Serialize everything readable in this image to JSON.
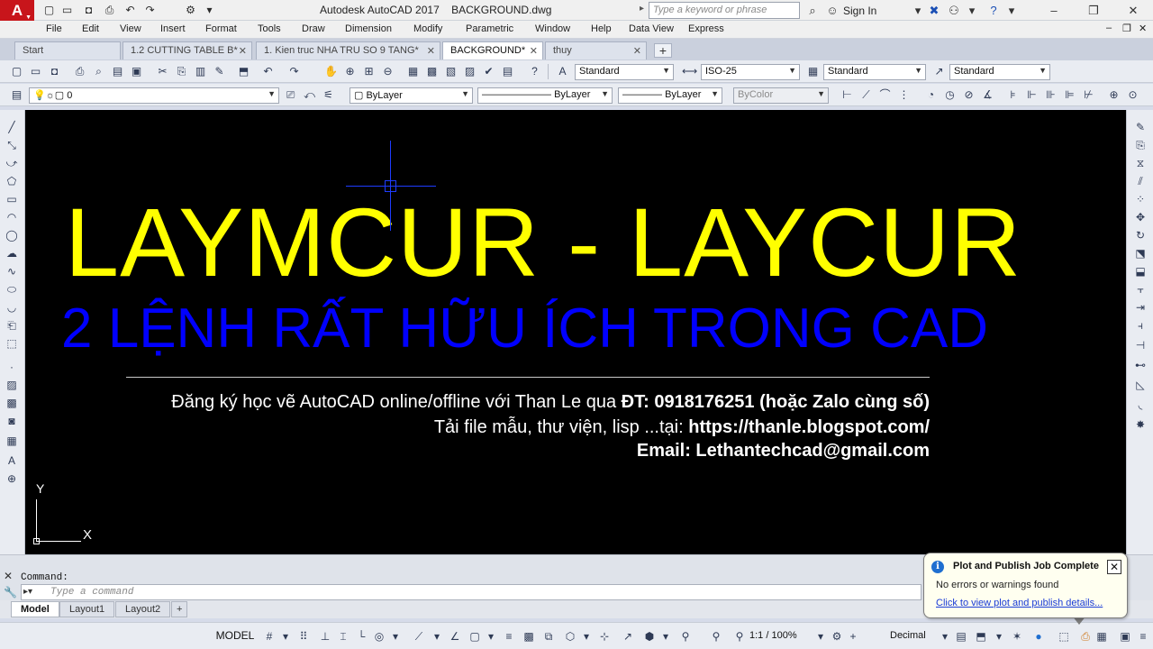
{
  "window": {
    "app_title": "Autodesk AutoCAD 2017    BACKGROUND.dwg",
    "logo_letter": "A",
    "search_placeholder": "Type a keyword or phrase",
    "sign_in": "Sign In"
  },
  "menu": [
    "File",
    "Edit",
    "View",
    "Insert",
    "Format",
    "Tools",
    "Draw",
    "Dimension",
    "Modify",
    "Parametric",
    "Window",
    "Help",
    "Data View",
    "Express"
  ],
  "tabs": [
    {
      "label": "Start",
      "closable": false,
      "active": false
    },
    {
      "label": "1.2 CUTTING TABLE B*",
      "closable": true,
      "active": false
    },
    {
      "label": "1. Kien truc NHA TRU SO 9 TANG*",
      "closable": true,
      "active": false
    },
    {
      "label": "BACKGROUND*",
      "closable": true,
      "active": true
    },
    {
      "label": "thuy",
      "closable": true,
      "active": false
    }
  ],
  "styles_toolbar": {
    "text_style": "Standard",
    "dim_style": "ISO-25",
    "table_style": "Standard",
    "mleader_style": "Standard"
  },
  "layers_toolbar": {
    "layer": "0",
    "color": "ByLayer",
    "linetype": "ByLayer",
    "lineweight": "ByLayer",
    "plot_style": "ByColor"
  },
  "drawing": {
    "title": "LAYMCUR - LAYCUR",
    "subtitle": "2 LỆNH RẤT HỮU ÍCH TRONG CAD",
    "line1_normal": "Đăng ký học vẽ AutoCAD online/offline với Than Le qua ",
    "line1_bold": "ĐT: 0918176251 (hoặc Zalo cùng số)",
    "line2_normal": "Tải file mẫu, thư viện, lisp ...tại:  ",
    "line2_bold": "https://thanle.blogspot.com/",
    "line3_bold": "Email:  Lethantechcad@gmail.com",
    "ucs_y": "Y",
    "ucs_x": "X"
  },
  "command": {
    "label": "Command:",
    "placeholder": "Type a command"
  },
  "layout_tabs": [
    {
      "label": "Model",
      "active": true
    },
    {
      "label": "Layout1",
      "active": false
    },
    {
      "label": "Layout2",
      "active": false
    }
  ],
  "status": {
    "model": "MODEL",
    "annotation_scale": "1:1 / 100%",
    "units": "Decimal"
  },
  "notification": {
    "title": "Plot and Publish Job Complete",
    "message": "No errors or warnings found",
    "link": "Click to view plot and publish details..."
  },
  "colors": {
    "canvas": "#000000",
    "title_yellow": "#ffff00",
    "subtitle_blue": "#0000ff",
    "logo_red": "#c8151b",
    "link_blue": "#1a3bd6"
  }
}
